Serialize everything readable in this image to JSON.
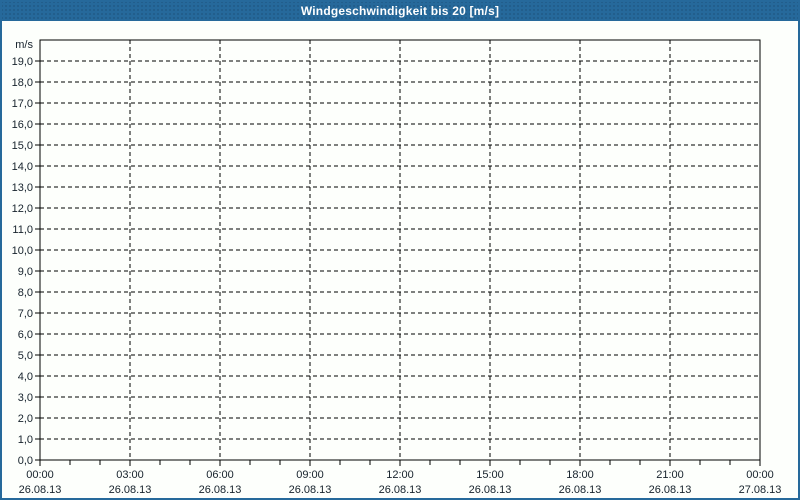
{
  "window": {
    "title": "Windgeschwindigkeit bis 20 [m/s]"
  },
  "colors": {
    "titlebar_bg": "#26699b",
    "title_text": "#ffffff",
    "frame_border": "#26699b",
    "canvas_bg": "#fdfffc",
    "grid_line": "#000000",
    "axis_line": "#000000",
    "tick_text": "#16222c"
  },
  "chart_data": {
    "type": "line",
    "title": "Windgeschwindigkeit bis 20 [m/s]",
    "xlabel": "",
    "ylabel": "m/s",
    "ylim": [
      0,
      20
    ],
    "ytick_step": 1,
    "ytick_labels": [
      "0,0",
      "1,0",
      "2,0",
      "3,0",
      "4,0",
      "5,0",
      "6,0",
      "7,0",
      "8,0",
      "9,0",
      "10,0",
      "11,0",
      "12,0",
      "13,0",
      "14,0",
      "15,0",
      "16,0",
      "17,0",
      "18,0",
      "19,0"
    ],
    "x_range_hours": [
      0,
      24
    ],
    "x_major_step_hours": 3,
    "x_minor_step_hours": 1,
    "x_major_labels": [
      {
        "time": "00:00",
        "date": "26.08.13"
      },
      {
        "time": "03:00",
        "date": "26.08.13"
      },
      {
        "time": "06:00",
        "date": "26.08.13"
      },
      {
        "time": "09:00",
        "date": "26.08.13"
      },
      {
        "time": "12:00",
        "date": "26.08.13"
      },
      {
        "time": "15:00",
        "date": "26.08.13"
      },
      {
        "time": "18:00",
        "date": "26.08.13"
      },
      {
        "time": "21:00",
        "date": "26.08.13"
      },
      {
        "time": "00:00",
        "date": "27.08.13"
      }
    ],
    "grid": "dashed",
    "legend": "none",
    "series": []
  }
}
